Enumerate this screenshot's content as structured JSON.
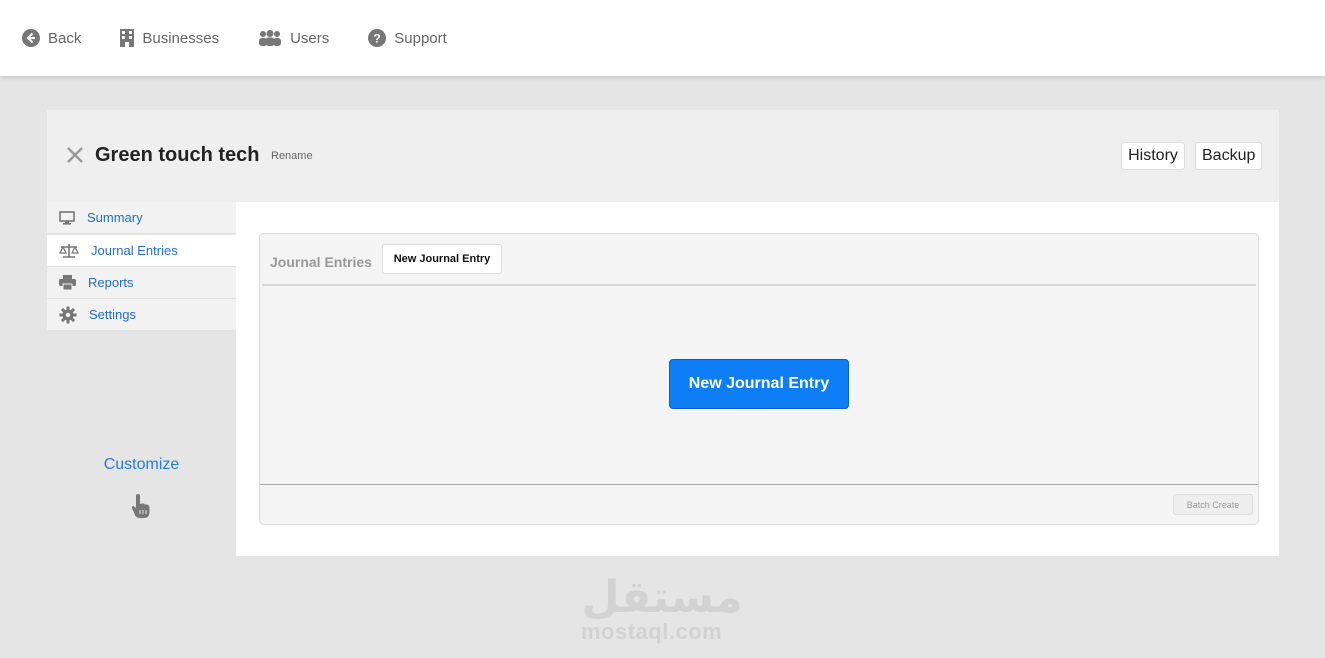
{
  "topnav": {
    "items": [
      {
        "label": "Back",
        "icon": "arrow-left-circle-icon"
      },
      {
        "label": "Businesses",
        "icon": "building-icon"
      },
      {
        "label": "Users",
        "icon": "users-icon"
      },
      {
        "label": "Support",
        "icon": "question-circle-icon"
      }
    ]
  },
  "header": {
    "business_name": "Green touch tech",
    "rename_label": "Rename",
    "history_label": "History",
    "backup_label": "Backup"
  },
  "sidebar": {
    "items": [
      {
        "label": "Summary",
        "icon": "monitor-icon"
      },
      {
        "label": "Journal Entries",
        "icon": "scale-icon",
        "active": true
      },
      {
        "label": "Reports",
        "icon": "printer-icon"
      },
      {
        "label": "Settings",
        "icon": "gear-icon"
      }
    ],
    "customize_label": "Customize"
  },
  "main": {
    "section_title": "Journal Entries",
    "tab_new_label": "New Journal Entry",
    "primary_button_label": "New Journal Entry",
    "batch_create_label": "Batch Create"
  },
  "watermark": {
    "arabic_text": "مستقل",
    "domain_text": "mostaql.com"
  },
  "colors": {
    "accent": "#0d7ef5",
    "link": "#1f6fd1",
    "background": "#e5e5e5"
  }
}
